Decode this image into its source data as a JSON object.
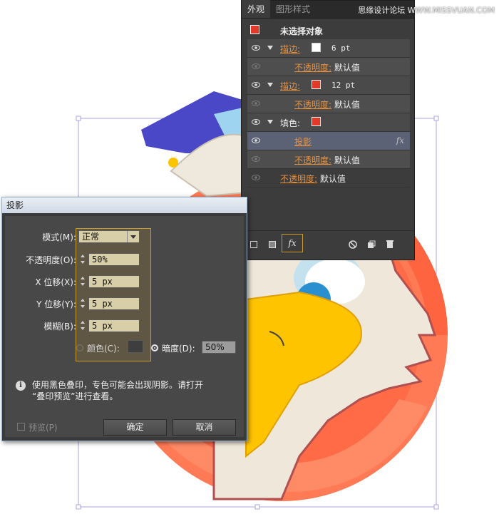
{
  "watermark": "思缘设计论坛 WWW.MISSVUAN.COM",
  "appearance_panel": {
    "tabs": [
      "外观",
      "图形样式"
    ],
    "header": "未选择对象",
    "rows": [
      {
        "kind": "stroke",
        "label": "描边:",
        "value": "6 pt"
      },
      {
        "kind": "opacity",
        "label": "不透明度:",
        "value": "默认值"
      },
      {
        "kind": "stroke",
        "label": "描边:",
        "value": "12 pt"
      },
      {
        "kind": "opacity",
        "label": "不透明度:",
        "value": "默认值"
      },
      {
        "kind": "fill",
        "label": "填色:"
      },
      {
        "kind": "effect",
        "label": "投影",
        "fx": "fx"
      },
      {
        "kind": "opacity",
        "label": "不透明度:",
        "value": "默认值"
      },
      {
        "kind": "opacity",
        "label": "不透明度:",
        "value": "默认值"
      }
    ],
    "fx_button": "fx"
  },
  "dialog": {
    "title": "投影",
    "mode_label": "模式(M):",
    "mode_value": "正常",
    "opacity_label": "不透明度(O):",
    "opacity_value": "50%",
    "x_label": "X 位移(X):",
    "x_value": "5 px",
    "y_label": "Y 位移(Y):",
    "y_value": "5 px",
    "blur_label": "模糊(B):",
    "blur_value": "5 px",
    "color_label": "颜色(C):",
    "darkness_label": "暗度(D):",
    "darkness_value": "50%",
    "info_line1": "使用黑色叠印，专色可能会出现阴影。请打开",
    "info_line2": "“叠印预览”进行查看。",
    "preview_label": "预览(P)",
    "ok_label": "确定",
    "cancel_label": "取消"
  },
  "colors": {
    "accent": "#e8903c",
    "highlight": "#c89a2a",
    "swatch_red": "#e23a2a"
  }
}
